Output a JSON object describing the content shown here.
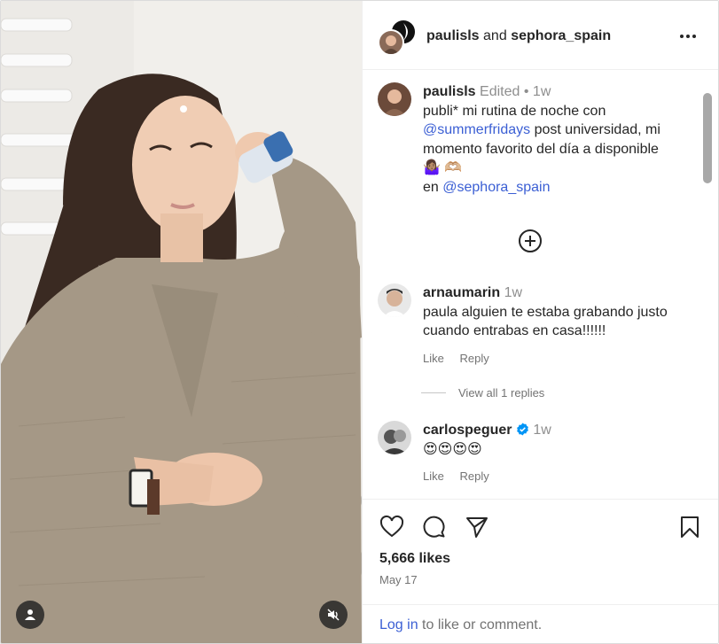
{
  "header": {
    "author": "paulisls",
    "connector": "and",
    "collaborator": "sephora_spain",
    "more_icon": "more-horizontal-icon"
  },
  "caption": {
    "username": "paulisls",
    "edited": "Edited",
    "separator": "•",
    "time": "1w",
    "text_1": "publi* mi rutina de noche con",
    "mention_1": "@summerfridays",
    "text_2": " post universidad, mi momento favorito del día a disponible",
    "emoji": "🤷🏽‍♀️ 🫶🏼",
    "text_3": "en ",
    "mention_2": "@sephora_spain",
    "more_icon": "plus-circle-icon"
  },
  "comments": [
    {
      "username": "arnaumarin",
      "time": "1w",
      "text": "paula alguien te estaba grabando justo cuando entrabas en casa!!!!!!",
      "like_label": "Like",
      "reply_label": "Reply",
      "view_replies": "View all 1 replies"
    },
    {
      "username": "carlospeguer",
      "verified": true,
      "time": "1w",
      "text": "😍😍😍😍",
      "like_label": "Like",
      "reply_label": "Reply"
    }
  ],
  "actions": {
    "like_icon": "heart-icon",
    "comment_icon": "comment-icon",
    "share_icon": "paper-plane-icon",
    "save_icon": "bookmark-icon"
  },
  "likes": "5,666 likes",
  "date": "May 17",
  "login": {
    "link": "Log in",
    "text": " to like or comment."
  },
  "media": {
    "user_icon": "user-tag-icon",
    "mute_icon": "speaker-muted-icon"
  },
  "colors": {
    "link": "#3b5fd4",
    "muted": "#737373",
    "verified": "#0095f6"
  }
}
